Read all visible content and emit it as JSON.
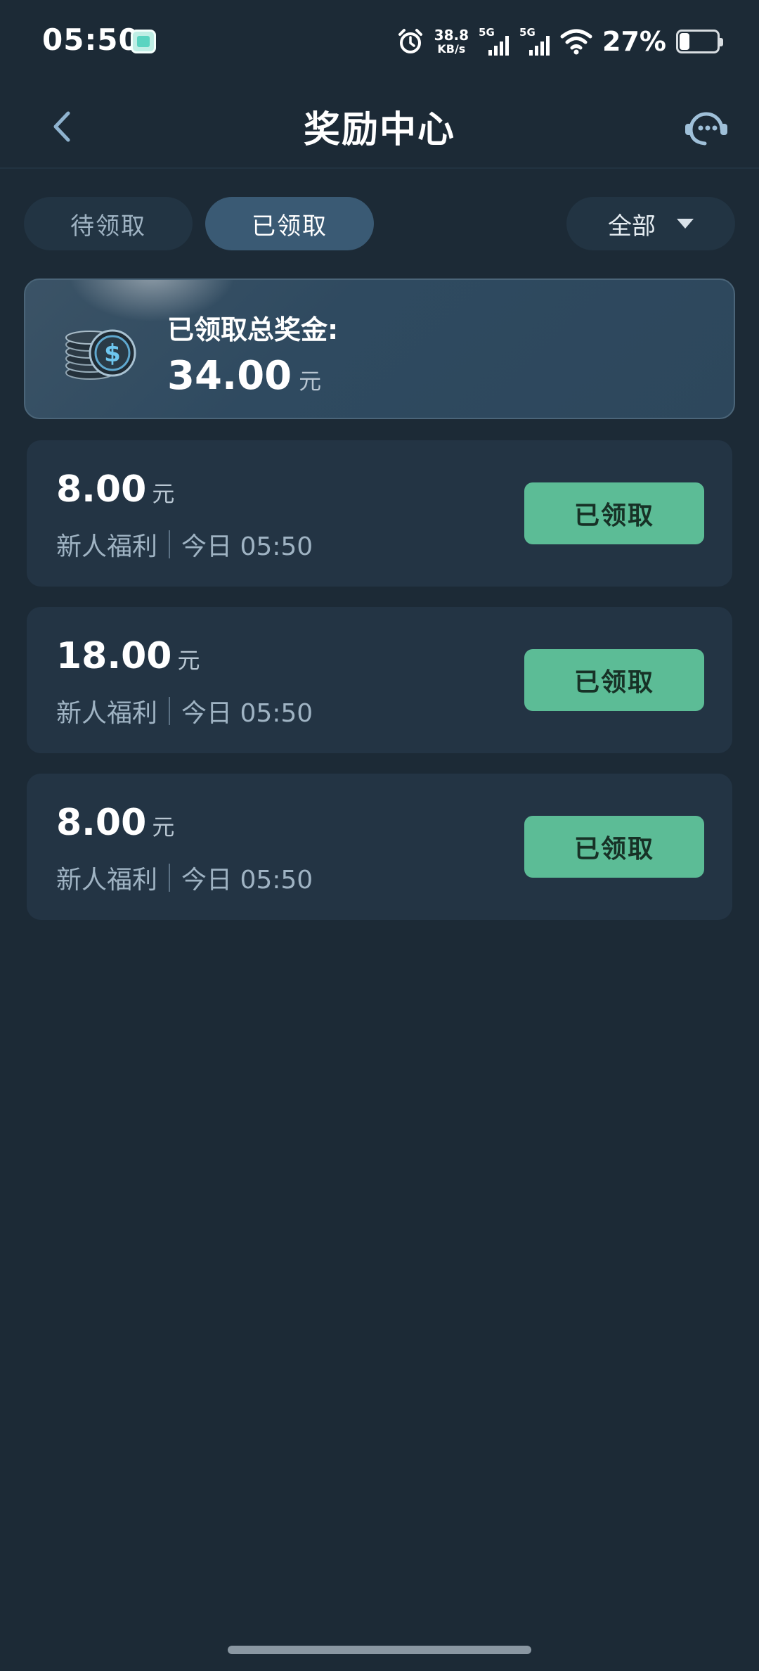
{
  "status_bar": {
    "time": "05:50",
    "net_speed_value": "38.8",
    "net_speed_unit": "KB/s",
    "sim1_label": "5G",
    "sim2_label": "5G",
    "battery_percent": "27%"
  },
  "header": {
    "title": "奖励中心"
  },
  "tabs": [
    {
      "label": "待领取",
      "active": false
    },
    {
      "label": "已领取",
      "active": true
    }
  ],
  "filter": {
    "selected": "全部"
  },
  "summary": {
    "label": "已领取总奖金:",
    "amount": "34.00",
    "unit": "元"
  },
  "rewards": [
    {
      "amount": "8.00",
      "unit": "元",
      "source": "新人福利",
      "time": "今日 05:50",
      "button_label": "已领取"
    },
    {
      "amount": "18.00",
      "unit": "元",
      "source": "新人福利",
      "time": "今日 05:50",
      "button_label": "已领取"
    },
    {
      "amount": "8.00",
      "unit": "元",
      "source": "新人福利",
      "time": "今日 05:50",
      "button_label": "已领取"
    }
  ],
  "colors": {
    "background": "#1c2a36",
    "card": "#233444",
    "accent_green": "#5cbc96",
    "active_tab": "#3a5a74"
  },
  "icons": {
    "back": "chevron-left-icon",
    "support": "customer-service-icon",
    "coins": "coins-stack-icon",
    "alarm": "alarm-icon",
    "wifi": "wifi-icon"
  }
}
